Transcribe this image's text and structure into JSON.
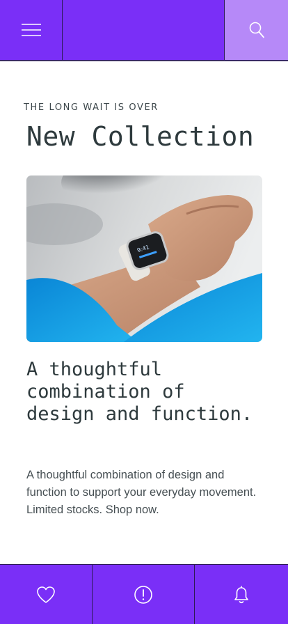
{
  "header": {
    "menu_icon": "hamburger-menu-icon",
    "search_icon": "search-icon",
    "colors": {
      "primary": "#7a2ff7",
      "search_bg": "#b689f8"
    }
  },
  "main": {
    "eyebrow": "THE LONG WAIT IS OVER",
    "title": "New Collection",
    "hero_image": "photo-smartwatch-on-wrist",
    "headline": "A thoughtful combination of design and function.",
    "body": "A thoughtful combination of design and function to support your everyday movement. Limited stocks. Shop now."
  },
  "bottom_nav": {
    "items": [
      {
        "icon": "heart-icon"
      },
      {
        "icon": "info-icon"
      },
      {
        "icon": "bell-icon"
      }
    ],
    "color": "#7a2ff7"
  }
}
